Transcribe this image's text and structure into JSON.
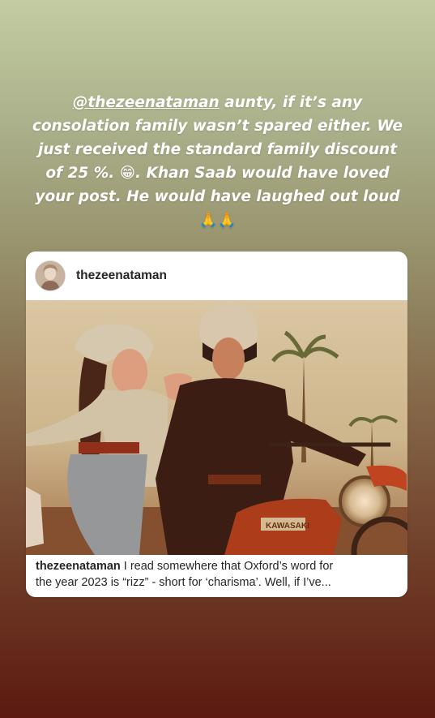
{
  "story": {
    "mention": "@thezeenataman",
    "text_line1_rest": " aunty, if it’s any",
    "text_line2": "consolation family wasn’t spared either. We",
    "text_line3": "just received the standard family discount",
    "text_line4_a": "of 25 %. ",
    "emoji_grin": "😁",
    "text_line4_b": ".  Khan Saab would have loved",
    "text_line5": "your post. He would have laughed out loud",
    "emoji_pray": "🙏🙏"
  },
  "post": {
    "username": "thezeenataman",
    "avatar_icon": "profile-avatar",
    "photo_brand_text": "KAWASAKI",
    "caption_user": "thezeenataman",
    "caption_line1": " I read somewhere that Oxford’s word for",
    "caption_line2": "the year 2023 is “rizz” - short for ‘charisma’. Well, if I’ve..."
  }
}
